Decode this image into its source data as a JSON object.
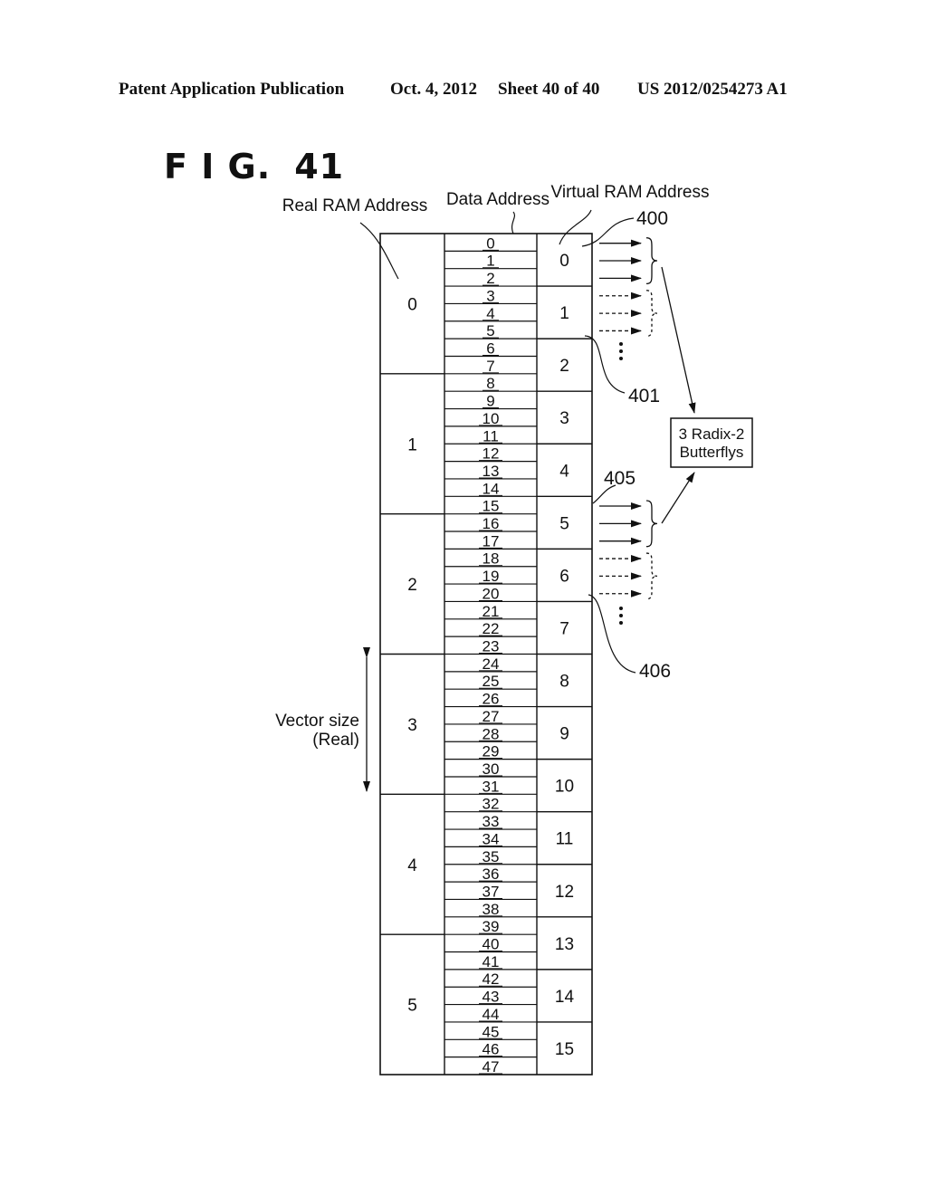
{
  "header": {
    "publication": "Patent Application Publication",
    "date": "Oct. 4, 2012",
    "sheet": "Sheet 40 of 40",
    "patent_number": "US 2012/0254273 A1"
  },
  "figure": {
    "label": "F I G.",
    "number": "41"
  },
  "columns": {
    "real": "Real RAM Address",
    "data": "Data Address",
    "virtual": "Virtual RAM Address"
  },
  "real_addresses": [
    "0",
    "1",
    "2",
    "3",
    "4",
    "5"
  ],
  "data_addresses": [
    "0",
    "1",
    "2",
    "3",
    "4",
    "5",
    "6",
    "7",
    "8",
    "9",
    "10",
    "11",
    "12",
    "13",
    "14",
    "15",
    "16",
    "17",
    "18",
    "19",
    "20",
    "21",
    "22",
    "23",
    "24",
    "25",
    "26",
    "27",
    "28",
    "29",
    "30",
    "31",
    "32",
    "33",
    "34",
    "35",
    "36",
    "37",
    "38",
    "39",
    "40",
    "41",
    "42",
    "43",
    "44",
    "45",
    "46",
    "47"
  ],
  "virtual_addresses": [
    "0",
    "1",
    "2",
    "3",
    "4",
    "5",
    "6",
    "7",
    "8",
    "9",
    "10",
    "11",
    "12",
    "13",
    "14",
    "15"
  ],
  "data_per_real": 8,
  "data_per_virtual": 3,
  "reference_numerals": {
    "r400": "400",
    "r401": "401",
    "r405": "405",
    "r406": "406"
  },
  "butterfly_box": {
    "line1": "3 Radix-2",
    "line2": "Butterflys"
  },
  "vector_size": {
    "line1": "Vector size",
    "line2": "(Real)"
  }
}
